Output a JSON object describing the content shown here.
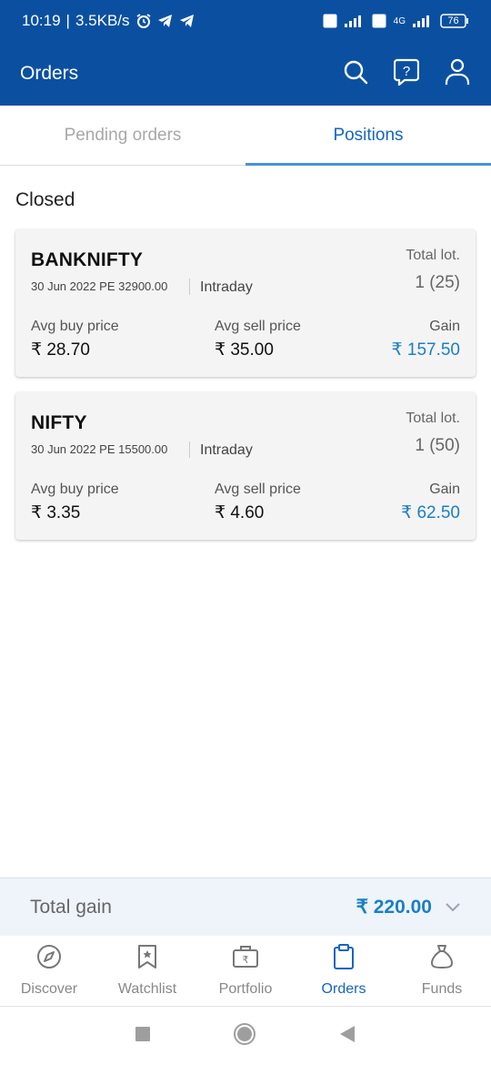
{
  "status_bar": {
    "time": "10:19",
    "speed": "3.5KB/s",
    "battery": "76",
    "network_label": "4G",
    "volte_label": "Vo LTE"
  },
  "app_bar": {
    "title": "Orders",
    "icons": [
      "search-icon",
      "help-icon",
      "profile-icon"
    ]
  },
  "tabs": [
    {
      "label": "Pending orders",
      "active": false
    },
    {
      "label": "Positions",
      "active": true
    }
  ],
  "section_title": "Closed",
  "labels": {
    "total_lot": "Total lot.",
    "avg_buy": "Avg buy price",
    "avg_sell": "Avg sell price",
    "gain": "Gain"
  },
  "positions": [
    {
      "symbol": "BANKNIFTY",
      "contract": "30 Jun 2022 PE 32900.00",
      "product": "Intraday",
      "lots": "1 (25)",
      "avg_buy": "₹ 28.70",
      "avg_sell": "₹ 35.00",
      "gain": "₹ 157.50"
    },
    {
      "symbol": "NIFTY",
      "contract": "30 Jun 2022 PE 15500.00",
      "product": "Intraday",
      "lots": "1 (50)",
      "avg_buy": "₹ 3.35",
      "avg_sell": "₹ 4.60",
      "gain": "₹ 62.50"
    }
  ],
  "total": {
    "label": "Total gain",
    "value": "₹ 220.00"
  },
  "bottom_nav": [
    {
      "label": "Discover",
      "icon": "compass-icon",
      "active": false
    },
    {
      "label": "Watchlist",
      "icon": "bookmark-icon",
      "active": false
    },
    {
      "label": "Portfolio",
      "icon": "briefcase-icon",
      "active": false
    },
    {
      "label": "Orders",
      "icon": "clipboard-icon",
      "active": true
    },
    {
      "label": "Funds",
      "icon": "moneybag-icon",
      "active": false
    }
  ],
  "colors": {
    "primary": "#0b50a0",
    "accent": "#1565c0",
    "gain": "#1a7fc4"
  }
}
